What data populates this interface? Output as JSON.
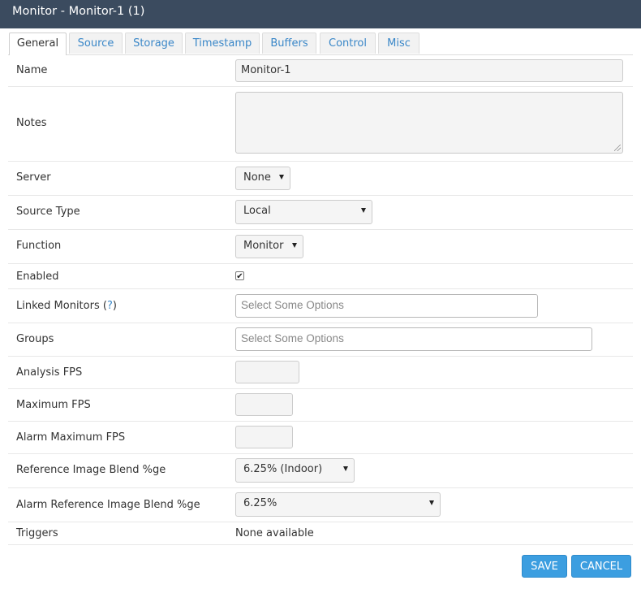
{
  "window": {
    "title": "Monitor - Monitor-1 (1)"
  },
  "tabs": [
    {
      "label": "General"
    },
    {
      "label": "Source"
    },
    {
      "label": "Storage"
    },
    {
      "label": "Timestamp"
    },
    {
      "label": "Buffers"
    },
    {
      "label": "Control"
    },
    {
      "label": "Misc"
    }
  ],
  "form": {
    "name": {
      "label": "Name",
      "value": "Monitor-1"
    },
    "notes": {
      "label": "Notes",
      "value": ""
    },
    "server": {
      "label": "Server",
      "value": "None"
    },
    "source_type": {
      "label": "Source Type",
      "value": "Local"
    },
    "function": {
      "label": "Function",
      "value": "Monitor"
    },
    "enabled": {
      "label": "Enabled",
      "checked": true,
      "check_glyph": "✔"
    },
    "linked_monitors": {
      "label": "Linked Monitors (",
      "help": "?",
      "label_end": ")",
      "placeholder": "Select Some Options"
    },
    "groups": {
      "label": "Groups",
      "placeholder": "Select Some Options"
    },
    "analysis_fps": {
      "label": "Analysis FPS",
      "value": ""
    },
    "maximum_fps": {
      "label": "Maximum FPS",
      "value": ""
    },
    "alarm_maximum_fps": {
      "label": "Alarm Maximum FPS",
      "value": ""
    },
    "ref_blend": {
      "label": "Reference Image Blend %ge",
      "value": "6.25% (Indoor)"
    },
    "alarm_ref_blend": {
      "label": "Alarm Reference Image Blend %ge",
      "value": "6.25%"
    },
    "triggers": {
      "label": "Triggers",
      "value": "None available"
    }
  },
  "buttons": {
    "save": "SAVE",
    "cancel": "CANCEL"
  },
  "colors": {
    "titlebar": "#3b4b5f",
    "accent": "#3c9ee0",
    "link": "#3a87c8"
  }
}
